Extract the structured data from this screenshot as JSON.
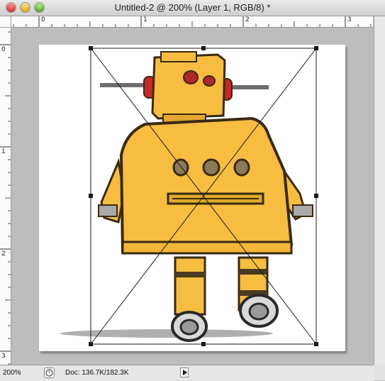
{
  "window": {
    "title": "Untitled-2 @ 200% (Layer 1, RGB/8) *"
  },
  "rulers": {
    "top": [
      "0",
      "1",
      "2",
      "3"
    ],
    "left": [
      "0",
      "1",
      "2",
      "3"
    ]
  },
  "status": {
    "zoom": "200%",
    "doc_info": "Doc: 136.7K/182.3K"
  },
  "colors": {
    "robot_body": "#f6bd41",
    "robot_outline": "#3a2a10",
    "robot_red": "#c8282a",
    "ground_shadow": "#6b6b6b"
  },
  "icons": {
    "close": "close-icon",
    "minimize": "minimize-icon",
    "zoom": "zoom-icon",
    "status_menu": "triangle-right-icon"
  }
}
